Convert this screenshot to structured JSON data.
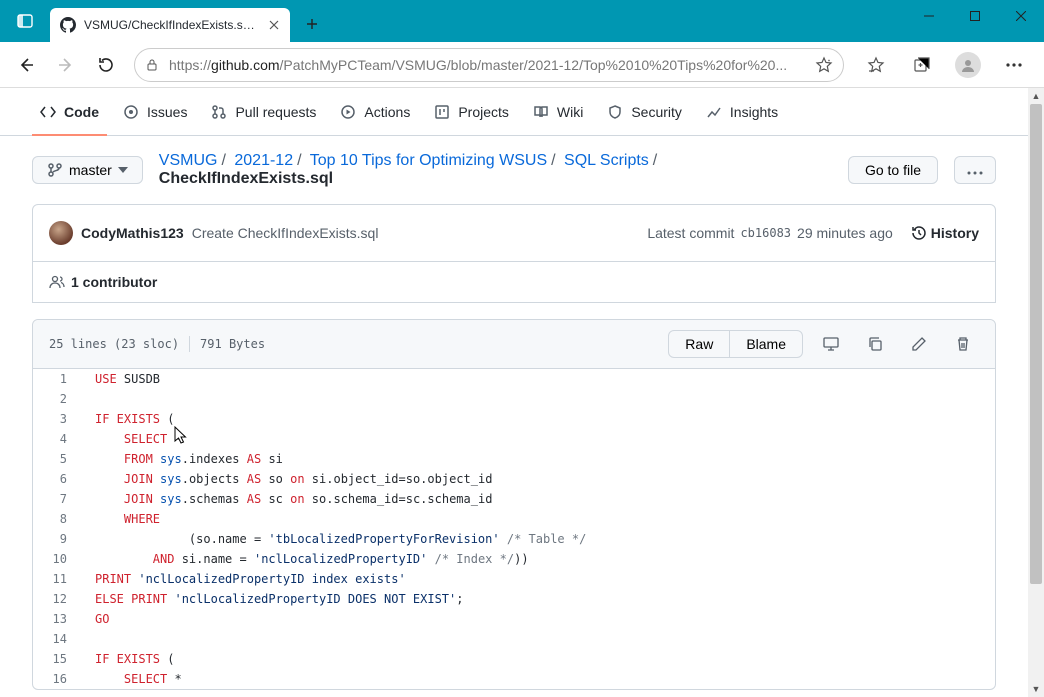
{
  "browser": {
    "tab_title": "VSMUG/CheckIfIndexExists.sql at",
    "url_prefix": "https://",
    "url_host": "github.com",
    "url_path": "/PatchMyPCTeam/VSMUG/blob/master/2021-12/Top%2010%20Tips%20for%20..."
  },
  "repo_nav": {
    "code": "Code",
    "issues": "Issues",
    "pulls": "Pull requests",
    "actions": "Actions",
    "projects": "Projects",
    "wiki": "Wiki",
    "security": "Security",
    "insights": "Insights"
  },
  "branch": {
    "name": "master"
  },
  "breadcrumb": {
    "parts": [
      "VSMUG",
      "2021-12",
      "Top 10 Tips for Optimizing WSUS",
      "SQL Scripts"
    ],
    "final": "CheckIfIndexExists.sql"
  },
  "buttons": {
    "go_to_file": "Go to file",
    "raw": "Raw",
    "blame": "Blame"
  },
  "commit": {
    "author": "CodyMathis123",
    "message": "Create CheckIfIndexExists.sql",
    "latest_label": "Latest commit",
    "hash": "cb16083",
    "when": "29 minutes ago",
    "history": "History"
  },
  "contributors": {
    "count_label": "1 contributor"
  },
  "file_stats": {
    "lines": "25 lines (23 sloc)",
    "size": "791 Bytes"
  },
  "code_lines": [
    [
      {
        "c": "k",
        "t": "USE"
      },
      {
        "c": "n",
        "t": " SUSDB"
      }
    ],
    [],
    [
      {
        "c": "k",
        "t": "IF EXISTS"
      },
      {
        "c": "n",
        "t": " ("
      }
    ],
    [
      {
        "c": "n",
        "t": "    "
      },
      {
        "c": "k",
        "t": "SELECT"
      },
      {
        "c": "n",
        "t": " "
      },
      {
        "c": "o",
        "t": "*"
      }
    ],
    [
      {
        "c": "n",
        "t": "    "
      },
      {
        "c": "k",
        "t": "FROM"
      },
      {
        "c": "n",
        "t": " "
      },
      {
        "c": "f",
        "t": "sys"
      },
      {
        "c": "n",
        "t": ".indexes "
      },
      {
        "c": "k",
        "t": "AS"
      },
      {
        "c": "n",
        "t": " si"
      }
    ],
    [
      {
        "c": "n",
        "t": "    "
      },
      {
        "c": "k",
        "t": "JOIN"
      },
      {
        "c": "n",
        "t": " "
      },
      {
        "c": "f",
        "t": "sys"
      },
      {
        "c": "n",
        "t": ".objects "
      },
      {
        "c": "k",
        "t": "AS"
      },
      {
        "c": "n",
        "t": " so "
      },
      {
        "c": "k",
        "t": "on"
      },
      {
        "c": "n",
        "t": " si.object_id"
      },
      {
        "c": "o",
        "t": "="
      },
      {
        "c": "n",
        "t": "so.object_id"
      }
    ],
    [
      {
        "c": "n",
        "t": "    "
      },
      {
        "c": "k",
        "t": "JOIN"
      },
      {
        "c": "n",
        "t": " "
      },
      {
        "c": "f",
        "t": "sys"
      },
      {
        "c": "n",
        "t": ".schemas "
      },
      {
        "c": "k",
        "t": "AS"
      },
      {
        "c": "n",
        "t": " sc "
      },
      {
        "c": "k",
        "t": "on"
      },
      {
        "c": "n",
        "t": " so.schema_id"
      },
      {
        "c": "o",
        "t": "="
      },
      {
        "c": "n",
        "t": "sc.schema_id"
      }
    ],
    [
      {
        "c": "n",
        "t": "    "
      },
      {
        "c": "k",
        "t": "WHERE"
      }
    ],
    [
      {
        "c": "n",
        "t": "             (so.name "
      },
      {
        "c": "o",
        "t": "="
      },
      {
        "c": "n",
        "t": " "
      },
      {
        "c": "s",
        "t": "'tbLocalizedPropertyForRevision'"
      },
      {
        "c": "n",
        "t": " "
      },
      {
        "c": "c",
        "t": "/* Table */"
      }
    ],
    [
      {
        "c": "n",
        "t": "        "
      },
      {
        "c": "k",
        "t": "AND"
      },
      {
        "c": "n",
        "t": " si.name "
      },
      {
        "c": "o",
        "t": "="
      },
      {
        "c": "n",
        "t": " "
      },
      {
        "c": "s",
        "t": "'nclLocalizedPropertyID'"
      },
      {
        "c": "n",
        "t": " "
      },
      {
        "c": "c",
        "t": "/* Index */"
      },
      {
        "c": "n",
        "t": "))"
      }
    ],
    [
      {
        "c": "k",
        "t": "PRINT"
      },
      {
        "c": "n",
        "t": " "
      },
      {
        "c": "s",
        "t": "'nclLocalizedPropertyID index exists'"
      }
    ],
    [
      {
        "c": "k",
        "t": "ELSE PRINT"
      },
      {
        "c": "n",
        "t": " "
      },
      {
        "c": "s",
        "t": "'nclLocalizedPropertyID DOES NOT EXIST'"
      },
      {
        "c": "n",
        "t": ";"
      }
    ],
    [
      {
        "c": "k",
        "t": "GO"
      }
    ],
    [],
    [
      {
        "c": "k",
        "t": "IF EXISTS"
      },
      {
        "c": "n",
        "t": " ("
      }
    ],
    [
      {
        "c": "n",
        "t": "    "
      },
      {
        "c": "k",
        "t": "SELECT"
      },
      {
        "c": "n",
        "t": " "
      },
      {
        "c": "o",
        "t": "*"
      }
    ]
  ]
}
